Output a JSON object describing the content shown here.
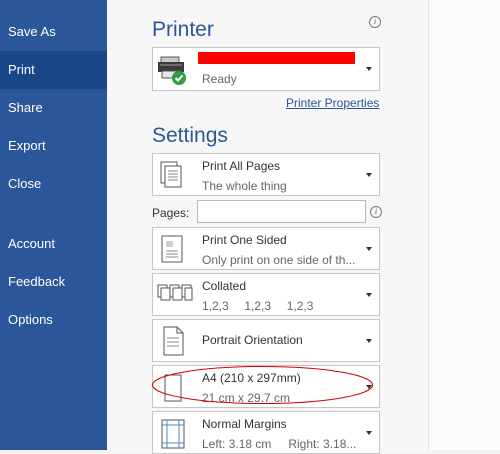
{
  "sidebar": {
    "items": [
      {
        "label": "Save As"
      },
      {
        "label": "Print",
        "active": true
      },
      {
        "label": "Share"
      },
      {
        "label": "Export"
      },
      {
        "label": "Close"
      },
      {
        "label": "Account"
      },
      {
        "label": "Feedback"
      },
      {
        "label": "Options"
      }
    ]
  },
  "printer": {
    "section_title": "Printer",
    "status": "Ready",
    "properties_link": "Printer Properties",
    "name_redacted": true
  },
  "settings": {
    "section_title": "Settings",
    "print_range": {
      "label": "Print All Pages",
      "sub": "The whole thing"
    },
    "pages_label": "Pages:",
    "pages_value": "",
    "sides": {
      "label": "Print One Sided",
      "sub": "Only print on one side of th..."
    },
    "collation": {
      "label": "Collated",
      "sub": [
        "1,2,3",
        "1,2,3",
        "1,2,3"
      ]
    },
    "orientation": {
      "label": "Portrait Orientation"
    },
    "paper_size": {
      "label": "A4 (210 x 297mm)",
      "sub": "21 cm x 29.7 cm"
    },
    "margins": {
      "label": "Normal Margins",
      "sub_left": "Left: 3.18 cm",
      "sub_right": "Right: 3.18..."
    }
  },
  "colors": {
    "sidebar_bg": "#2b579a",
    "sidebar_active": "#19478a",
    "accent": "#2b579a",
    "redaction": "#ff0000",
    "annotation": "#d40000",
    "ready_check": "#2e9e3f"
  },
  "icons": [
    "info-icon",
    "printer-icon",
    "pages-stack-icon",
    "one-sided-icon",
    "collated-icon",
    "portrait-page-icon",
    "paper-size-icon",
    "margins-icon",
    "chevron-down-icon"
  ]
}
